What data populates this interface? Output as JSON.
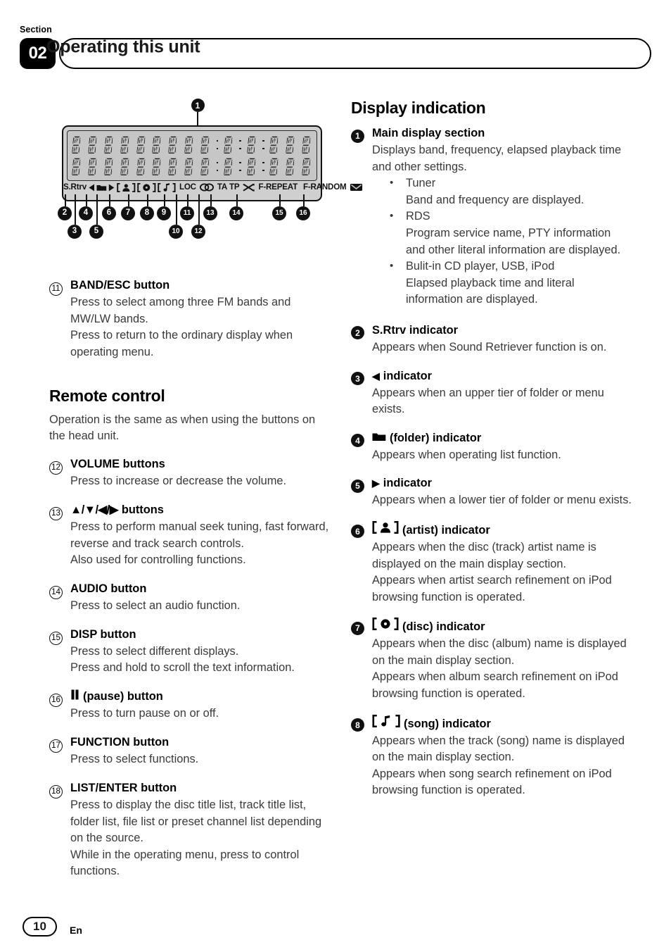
{
  "header": {
    "section_word": "Section",
    "section_number": "02",
    "title": "Operating this unit"
  },
  "figure": {
    "callout_top": "1",
    "indicator_labels": {
      "srtrv": "S.Rtrv",
      "loc": "LOC",
      "ta": "TA",
      "tp": "TP",
      "f_repeat": "F-REPEAT",
      "f_random": "F-RANDOM"
    },
    "callout_numbers_row1": [
      "2",
      "4",
      "6",
      "7",
      "8",
      "9",
      "11",
      "13",
      "14",
      "15",
      "16"
    ],
    "callout_numbers_row2": [
      "3",
      "5",
      "10",
      "12"
    ]
  },
  "left_column": {
    "entry_11": {
      "num": "11",
      "title": "BAND/ESC button",
      "lines": [
        "Press to select among three FM bands and MW/LW bands.",
        "Press to return to the ordinary display when operating menu."
      ]
    },
    "remote_heading": "Remote control",
    "remote_intro": "Operation is the same as when using the buttons on the head unit.",
    "entry_12": {
      "num": "12",
      "title": "VOLUME buttons",
      "lines": [
        "Press to increase or decrease the volume."
      ]
    },
    "entry_13": {
      "num": "13",
      "title": "buttons",
      "glyph_text": "▲/▼/◀/▶",
      "lines": [
        "Press to perform manual seek tuning, fast forward, reverse and track search controls.",
        "Also used for controlling functions."
      ]
    },
    "entry_14": {
      "num": "14",
      "title": "AUDIO button",
      "lines": [
        "Press to select an audio function."
      ]
    },
    "entry_15": {
      "num": "15",
      "title": "DISP button",
      "lines": [
        "Press to select different displays.",
        "Press and hold to scroll the text information."
      ]
    },
    "entry_16": {
      "num": "16",
      "title": "(pause) button",
      "glyph_text": "▐▐",
      "lines": [
        "Press to turn pause on or off."
      ]
    },
    "entry_17": {
      "num": "17",
      "title": "FUNCTION button",
      "lines": [
        "Press to select functions."
      ]
    },
    "entry_18": {
      "num": "18",
      "title": "LIST/ENTER button",
      "lines": [
        "Press to display the disc title list, track title list, folder list, file list or preset channel list depending on the source.",
        "While in the operating menu, press to control functions."
      ]
    }
  },
  "right_column": {
    "heading": "Display indication",
    "entry_1": {
      "num": "1",
      "title": "Main display section",
      "intro": "Displays band, frequency, elapsed playback time and other settings.",
      "bullets": [
        {
          "label": "Tuner",
          "text": "Band and frequency are displayed."
        },
        {
          "label": "RDS",
          "text": "Program service name, PTY information and other literal information are displayed."
        },
        {
          "label": "Bulit-in CD player, USB, iPod",
          "text": "Elapsed playback time and literal information are displayed."
        }
      ]
    },
    "entry_2": {
      "num": "2",
      "title": "S.Rtrv indicator",
      "lines": [
        "Appears when Sound Retriever function is on."
      ]
    },
    "entry_3": {
      "num": "3",
      "title": "indicator",
      "glyph_text": "◀",
      "lines": [
        "Appears when an upper tier of folder or menu exists."
      ]
    },
    "entry_4": {
      "num": "4",
      "title": "(folder) indicator",
      "lines": [
        "Appears when operating list function."
      ]
    },
    "entry_5": {
      "num": "5",
      "title": "indicator",
      "glyph_text": "▶",
      "lines": [
        "Appears when a lower tier of folder or menu exists."
      ]
    },
    "entry_6": {
      "num": "6",
      "title": "(artist) indicator",
      "lines": [
        "Appears when the disc (track) artist name is displayed on the main display section.",
        "Appears when artist search refinement on iPod browsing function is operated."
      ]
    },
    "entry_7": {
      "num": "7",
      "title": "(disc) indicator",
      "lines": [
        "Appears when the disc (album) name is displayed on the main display section.",
        "Appears when album search refinement on iPod browsing function is operated."
      ]
    },
    "entry_8": {
      "num": "8",
      "title": "(song) indicator",
      "lines": [
        "Appears when the track (song) name is displayed on the main display section.",
        "Appears when song search refinement on iPod browsing function is operated."
      ]
    }
  },
  "footer": {
    "page_number": "10",
    "language": "En"
  }
}
